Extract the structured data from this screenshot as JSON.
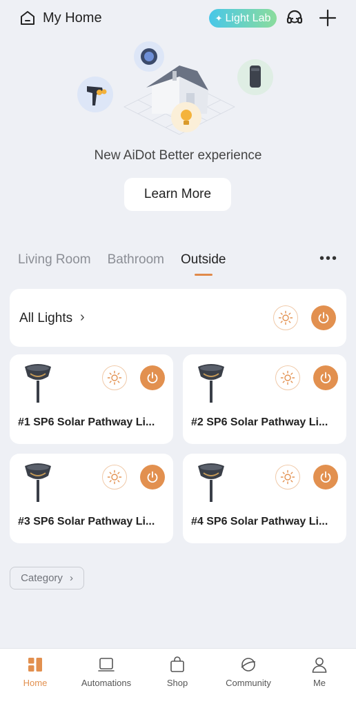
{
  "header": {
    "title": "My Home",
    "light_lab_label": "Light Lab",
    "icons": [
      "home-outline-icon",
      "headset-icon",
      "plus-icon"
    ]
  },
  "banner": {
    "text": "New AiDot Better experience",
    "button_label": "Learn More"
  },
  "tabs": {
    "items": [
      "Living Room",
      "Bathroom",
      "Outside"
    ],
    "active": "Outside",
    "more_label": "•••"
  },
  "all_lights": {
    "label": "All Lights",
    "chevron": "›"
  },
  "devices": [
    {
      "name": "#1 SP6 Solar Pathway Li..."
    },
    {
      "name": "#2 SP6 Solar Pathway Li..."
    },
    {
      "name": "#3 SP6 Solar Pathway Li..."
    },
    {
      "name": "#4 SP6 Solar Pathway Li..."
    }
  ],
  "category": {
    "label": "Category",
    "chevron": "›"
  },
  "bottom_nav": {
    "items": [
      "Home",
      "Automations",
      "Shop",
      "Community",
      "Me"
    ],
    "active": "Home"
  },
  "colors": {
    "accent": "#e2904f",
    "background": "#eef0f5",
    "light_lab_gradient": [
      "#48c7e8",
      "#8bdc9c"
    ]
  }
}
